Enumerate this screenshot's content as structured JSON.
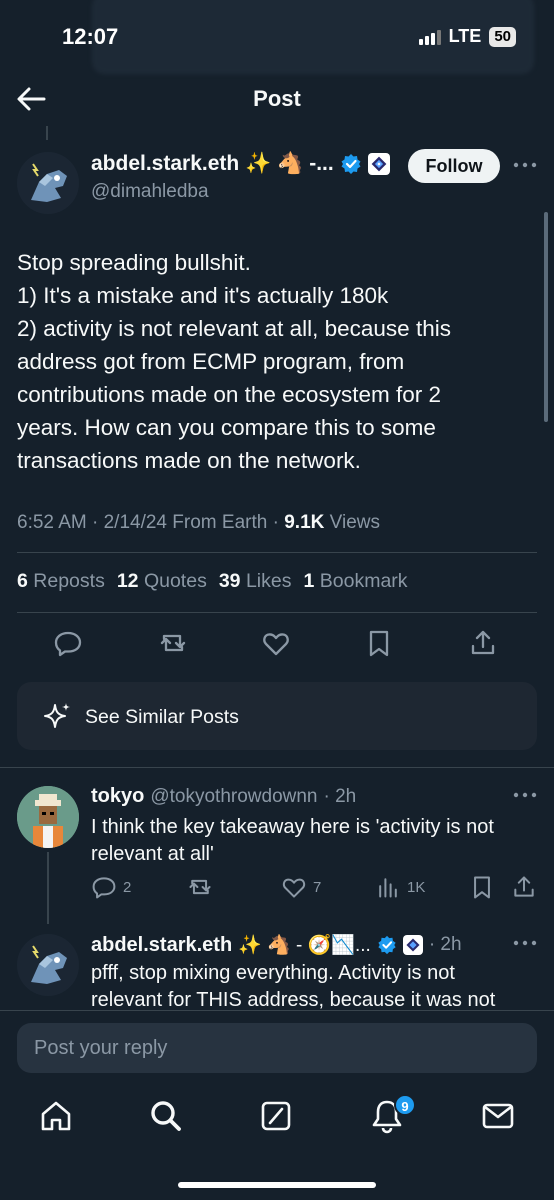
{
  "status_bar": {
    "time": "12:07",
    "network": "LTE",
    "battery": "50"
  },
  "header": {
    "title": "Post"
  },
  "post": {
    "author": {
      "name": "abdel.stark.eth",
      "name_suffix": "✨ 🐴 -...",
      "handle": "@dimahledba"
    },
    "follow_label": "Follow",
    "text_lines": [
      "Stop spreading bullshit.",
      "1) It's a mistake and it's actually 180k",
      "2) activity is not relevant at all, because this",
      "address got from ECMP program, from",
      "contributions made on the ecosystem for 2",
      "years. How can you compare this to some",
      "transactions made on the network."
    ],
    "meta": {
      "time": "6:52 AM",
      "date": "2/14/24",
      "source": "From Earth",
      "views_count": "9.1K",
      "views_label": "Views"
    },
    "stats": {
      "reposts_count": "6",
      "reposts_label": "Reposts",
      "quotes_count": "12",
      "quotes_label": "Quotes",
      "likes_count": "39",
      "likes_label": "Likes",
      "bookmarks_count": "1",
      "bookmarks_label": "Bookmark"
    },
    "actions": [
      "reply-icon",
      "repost-icon",
      "like-icon",
      "bookmark-icon",
      "share-icon"
    ]
  },
  "similar": {
    "label": "See Similar Posts"
  },
  "replies": [
    {
      "name": "tokyo",
      "handle": "@tokyothrowdownn",
      "time": "· 2h",
      "lines": [
        "I think the key takeaway here is 'activity is not",
        "relevant at all'"
      ],
      "reply_count": "2",
      "repost_count": "",
      "like_count": "7",
      "views_count": "1K"
    },
    {
      "name": "abdel.stark.eth",
      "name_suffix": "✨ 🐴 - 🧭📉...",
      "time": "· 2h",
      "lines": [
        "pfff, stop mixing everything. Activity is not",
        "relevant for THIS address, because it was not"
      ]
    }
  ],
  "composer": {
    "placeholder": "Post your reply"
  },
  "tabbar": {
    "notifications_badge": "9"
  },
  "colors": {
    "background": "#15202b",
    "accent": "#1d9bf0",
    "muted": "#8b98a5",
    "divider": "#38444d"
  }
}
